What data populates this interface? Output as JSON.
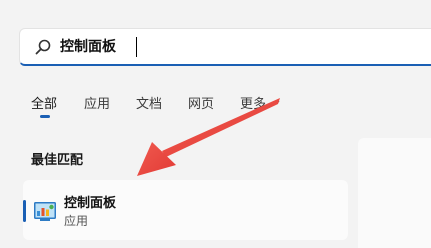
{
  "search": {
    "value": "控制面板",
    "icon": "search-icon"
  },
  "tabs": {
    "items": [
      {
        "label": "全部"
      },
      {
        "label": "应用"
      },
      {
        "label": "文档"
      },
      {
        "label": "网页"
      },
      {
        "label": "更多"
      }
    ]
  },
  "best_match": {
    "title": "最佳匹配",
    "result": {
      "title": "控制面板",
      "subtitle": "应用",
      "icon": "control-panel-icon"
    }
  },
  "colors": {
    "accent": "#1a5fb4",
    "annotation_arrow": "#e8463f"
  }
}
